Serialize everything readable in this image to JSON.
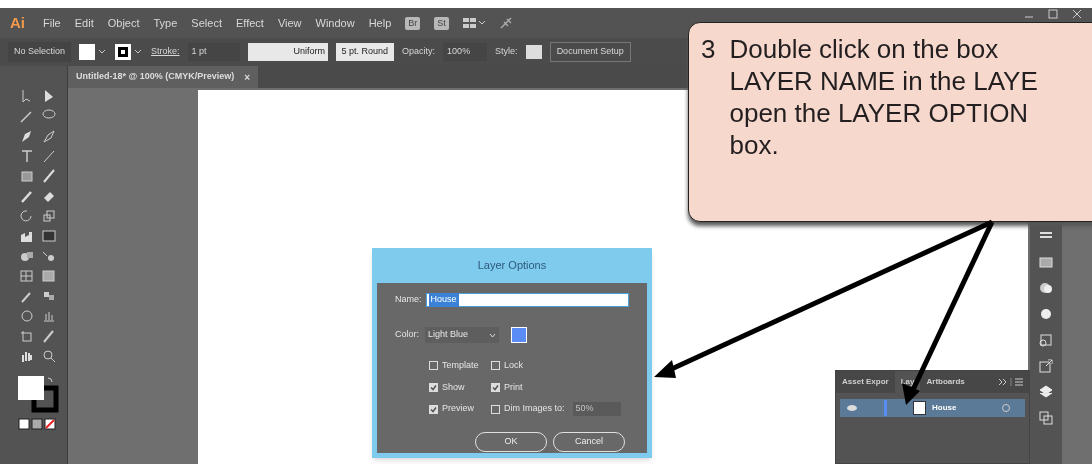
{
  "menu_bar": {
    "logo": "Ai",
    "items": [
      "File",
      "Edit",
      "Object",
      "Type",
      "Select",
      "Effect",
      "View",
      "Window",
      "Help"
    ],
    "badges": [
      "Br",
      "St"
    ]
  },
  "control_bar": {
    "selection": "No Selection",
    "stroke_label": "Stroke:",
    "stroke_value": "1 pt",
    "profile": "Uniform",
    "brush": "5 pt. Round",
    "opacity_label": "Opacity:",
    "opacity_value": "100%",
    "style_label": "Style:",
    "document_setup": "Document Setup"
  },
  "document_tab": {
    "title": "Untitled-18* @ 100% (CMYK/Preview)",
    "close": "×"
  },
  "dialog": {
    "title": "Layer Options",
    "name_label": "Name:",
    "name_value": "House",
    "color_label": "Color:",
    "color_value": "Light Blue",
    "color": "#5b8cf5",
    "options": [
      {
        "label": "Template",
        "checked": false
      },
      {
        "label": "Lock",
        "checked": false
      },
      {
        "label": "Show",
        "checked": true
      },
      {
        "label": "Print",
        "checked": true
      },
      {
        "label": "Preview",
        "checked": true
      },
      {
        "label": "Dim Images to:",
        "checked": false
      }
    ],
    "dim_value": "50%",
    "buttons": [
      "OK",
      "Cancel"
    ]
  },
  "layers_panel": {
    "tabs": [
      {
        "label": "Asset Expor",
        "selected": false
      },
      {
        "label": "Lay",
        "selected": true
      },
      {
        "label": "Artboards",
        "selected": false
      }
    ],
    "layers": [
      {
        "name": "House",
        "selected": true,
        "color": "#5b8cf5"
      }
    ]
  },
  "callout": {
    "number": "3",
    "lines": [
      "Double click on the box",
      "LAYER NAME in the LAYE",
      "open the LAYER OPTION",
      "box."
    ]
  }
}
